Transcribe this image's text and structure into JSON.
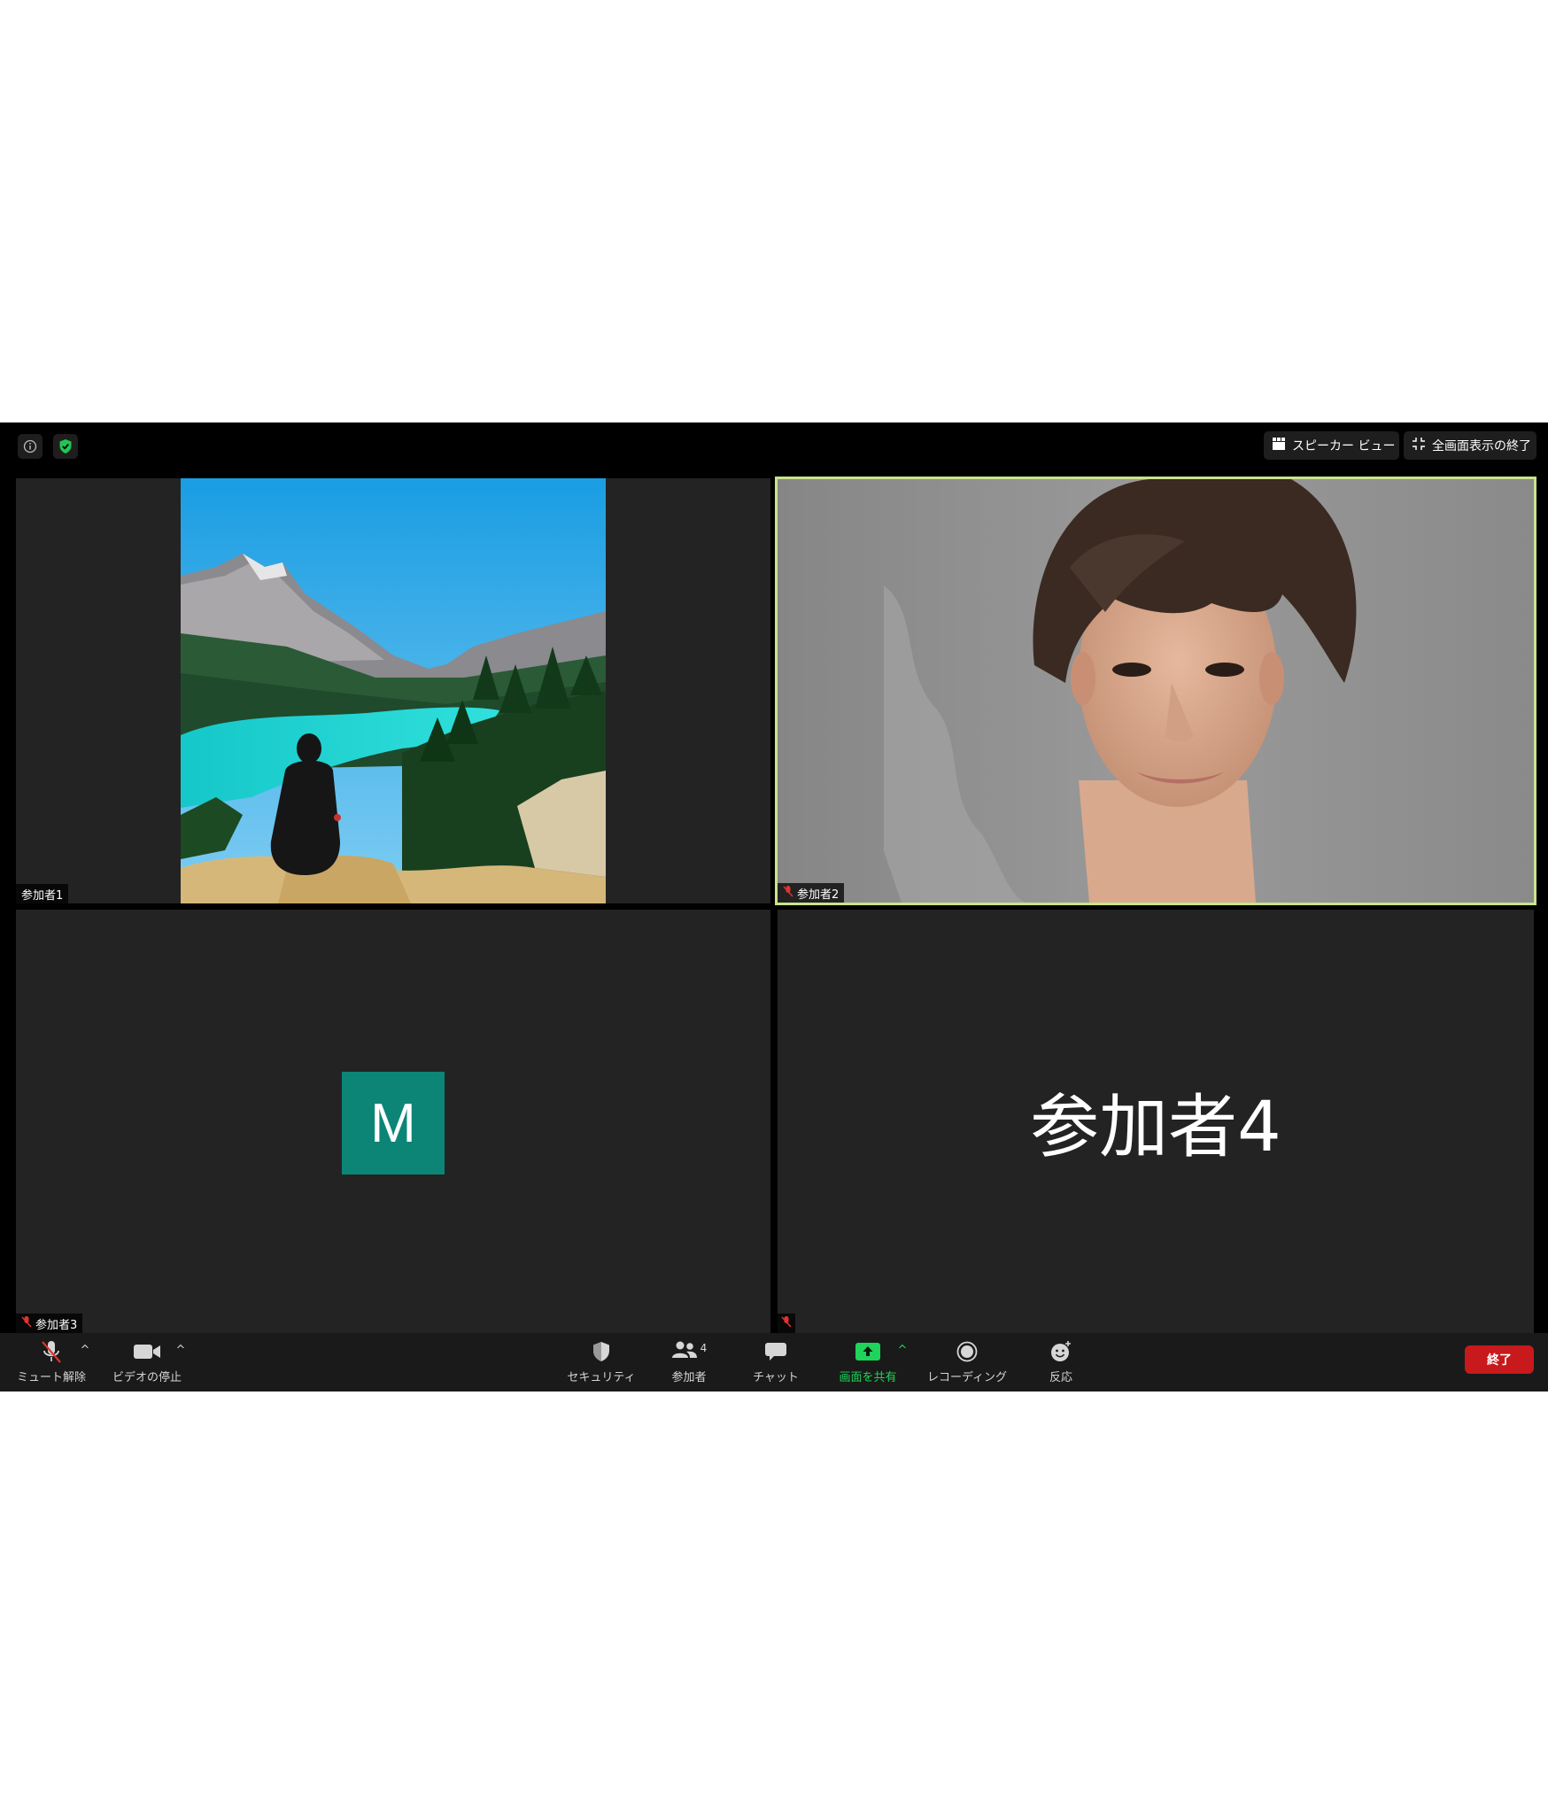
{
  "top_bar": {
    "info_icon": "info-icon",
    "security_badge_icon": "shield-check-icon",
    "speaker_view_label": "スピーカー ビュー",
    "exit_fullscreen_label": "全画面表示の終了"
  },
  "participants": [
    {
      "name": "参加者1",
      "muted": false,
      "video": "photo-lake-mountains"
    },
    {
      "name": "参加者2",
      "muted": true,
      "video": "photo-person-portrait",
      "active_speaker": true
    },
    {
      "name": "参加者3",
      "muted": true,
      "avatar_letter": "M",
      "avatar_color": "#0c8577"
    },
    {
      "name": "参加者4",
      "muted": true,
      "display_text": "参加者4"
    }
  ],
  "toolbar": {
    "unmute_label": "ミュート解除",
    "stop_video_label": "ビデオの停止",
    "security_label": "セキュリティ",
    "participants_label": "参加者",
    "participants_count": "4",
    "chat_label": "チャット",
    "share_screen_label": "画面を共有",
    "recording_label": "レコーディング",
    "reactions_label": "反応",
    "end_label": "終了"
  },
  "colors": {
    "background": "#000000",
    "tile": "#232323",
    "active_speaker_border": "#c9e48b",
    "share_green": "#1fd35b",
    "end_red": "#c8191c",
    "muted_red": "#e0322f"
  }
}
